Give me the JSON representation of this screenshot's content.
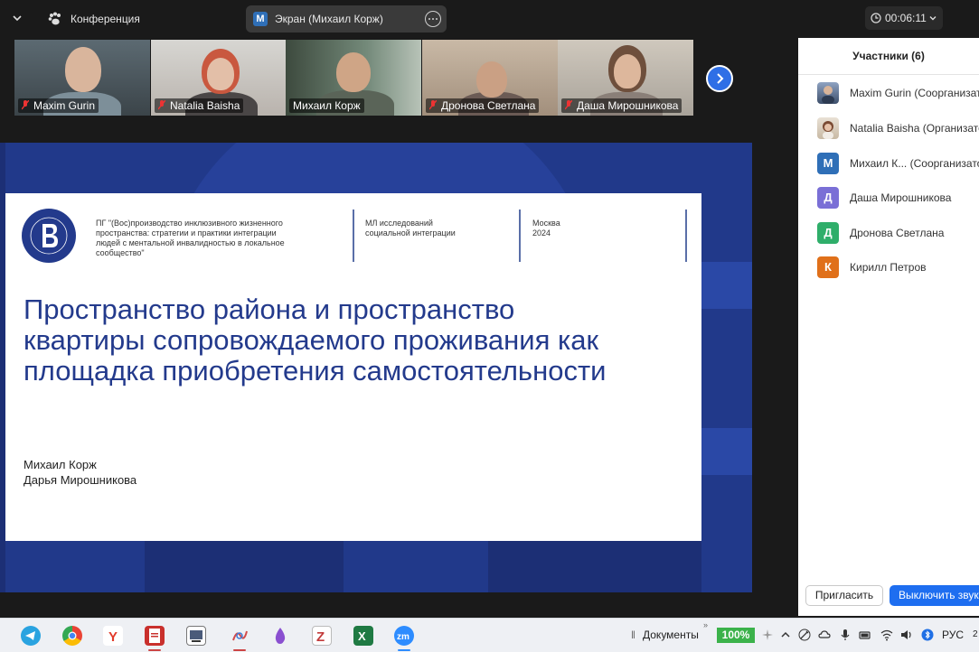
{
  "topbar": {
    "meeting_title": "Конференция",
    "screen_share": {
      "avatar_letter": "M",
      "label": "Экран (Михаил Корж)"
    },
    "timer": "00:06:11"
  },
  "videos": [
    {
      "name": "Maxim Gurin"
    },
    {
      "name": "Natalia Baisha"
    },
    {
      "name": "Михаил Корж"
    },
    {
      "name": "Дронова Светлана"
    },
    {
      "name": "Даша Мирошникова"
    }
  ],
  "slide": {
    "header_left": [
      "ПГ \"(Вос)производство инклюзивного жизненного",
      "пространства: стратегии и практики интеграции",
      "людей с ментальной инвалидностью в локальное",
      "сообщество\""
    ],
    "header_mid": [
      "МЛ исследований",
      "социальной интеграции"
    ],
    "header_right": [
      "Москва",
      "2024"
    ],
    "title_lines": [
      "Пространство района и пространство",
      "квартиры сопровождаемого проживания как",
      "площадка приобретения самостоятельности"
    ],
    "authors": [
      "Михаил Корж",
      "Дарья Мирошникова"
    ],
    "colors": {
      "background": "#21398a",
      "title": "#233a8c"
    }
  },
  "participants": {
    "title": "Участники (6)",
    "list": [
      {
        "avatar": "photo",
        "name": "Maxim Gurin (Соорганизатор)"
      },
      {
        "avatar": "photo",
        "name": "Natalia Baisha (Организатор)"
      },
      {
        "avatar": "М",
        "color": "#2f6fb7",
        "name": "Михаил К...  (Соорганизатор)"
      },
      {
        "avatar": "Д",
        "color": "#7a6fd6",
        "name": "Даша Мирошникова"
      },
      {
        "avatar": "Д",
        "color": "#2fae6a",
        "name": "Дронова Светлана"
      },
      {
        "avatar": "К",
        "color": "#e0701a",
        "name": "Кирилл Петров"
      }
    ],
    "invite_label": "Пригласить",
    "mute_all_label": "Выключить звук"
  },
  "taskbar": {
    "apps": [
      "telegram",
      "chrome",
      "yandex-browser",
      "pdf-reader",
      "file-manager",
      "sketch-app",
      "purple-app",
      "zotero",
      "excel",
      "zoom"
    ],
    "documents_label": "Документы",
    "battery": "100%",
    "language": "РУС",
    "clock_partial": "2"
  }
}
